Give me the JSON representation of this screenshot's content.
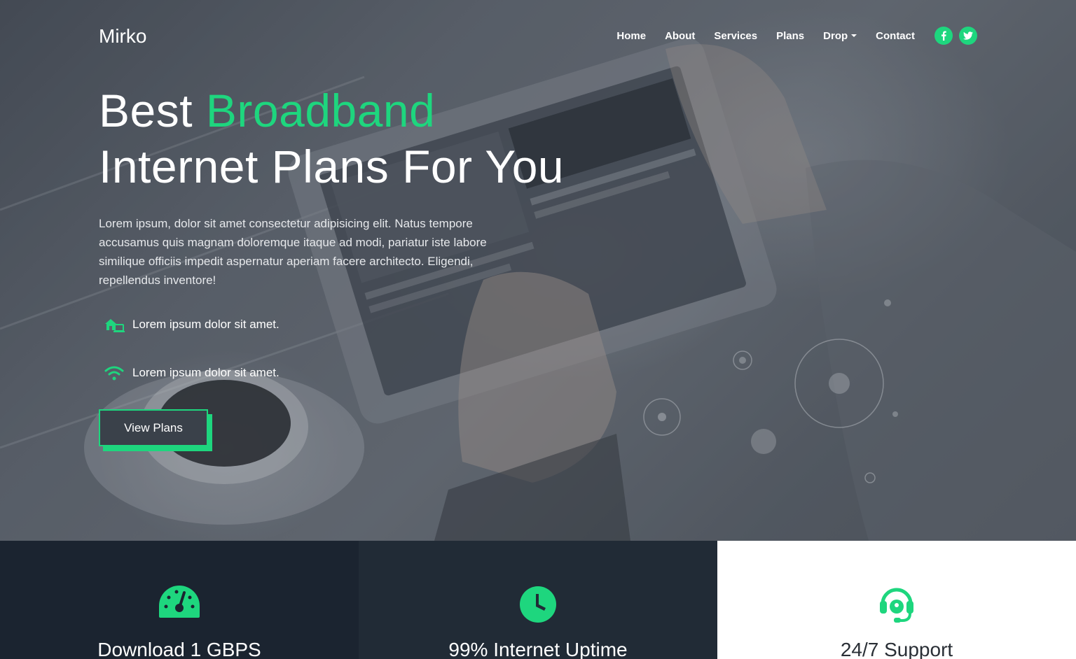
{
  "brand": {
    "name": "Mirko"
  },
  "nav": {
    "items": [
      {
        "label": "Home"
      },
      {
        "label": "About"
      },
      {
        "label": "Services"
      },
      {
        "label": "Plans"
      },
      {
        "label": "Drop"
      },
      {
        "label": "Contact"
      }
    ],
    "social": [
      {
        "icon": "facebook-icon"
      },
      {
        "icon": "twitter-icon"
      }
    ]
  },
  "hero": {
    "headline_plain": "Best ",
    "headline_accent": "Broadband",
    "headline_line2": "Internet Plans For You",
    "paragraph": "Lorem ipsum, dolor sit amet consectetur adipisicing elit. Natus tempore accusamus quis magnam doloremque itaque ad modi, pariatur iste labore similique officiis impedit aspernatur aperiam facere architecto. Eligendi, repellendus inventore!",
    "features": [
      {
        "icon": "house-network-icon",
        "text": "Lorem ipsum dolor sit amet."
      },
      {
        "icon": "wifi-icon",
        "text": "Lorem ipsum dolor sit amet."
      }
    ],
    "cta_label": "View Plans"
  },
  "highlights": [
    {
      "icon": "speedometer-icon",
      "title": "Download 1 GBPS"
    },
    {
      "icon": "clock-icon",
      "title": "99% Internet Uptime"
    },
    {
      "icon": "headset-icon",
      "title": "24/7 Support"
    }
  ],
  "colors": {
    "accent": "#1ed67e",
    "dark_1": "#1b2430",
    "dark_2": "#212b36",
    "light": "#ffffff"
  }
}
